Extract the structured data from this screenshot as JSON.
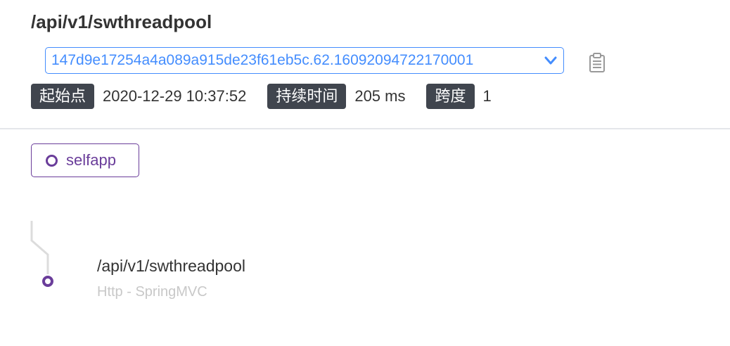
{
  "header": {
    "title": "/api/v1/swthreadpool"
  },
  "trace_selector": {
    "selected": "147d9e17254a4a089a915de23f61eb5c.62.16092094722170001"
  },
  "meta": {
    "start_label": "起始点",
    "start_value": "2020-12-29 10:37:52",
    "duration_label": "持续时间",
    "duration_value": "205 ms",
    "span_label": "跨度",
    "span_value": "1"
  },
  "service": {
    "label": "selfapp",
    "color": "#6a3d9a"
  },
  "spans": [
    {
      "name": "/api/v1/swthreadpool",
      "type": "Http - SpringMVC"
    }
  ],
  "icons": {
    "dropdown": "chevron-down-icon",
    "copy": "clipboard-icon",
    "service": "ring-icon",
    "node": "span-node-icon"
  },
  "colors": {
    "accent": "#448dfe",
    "service": "#6a3d9a",
    "tag_bg": "#40454e"
  }
}
